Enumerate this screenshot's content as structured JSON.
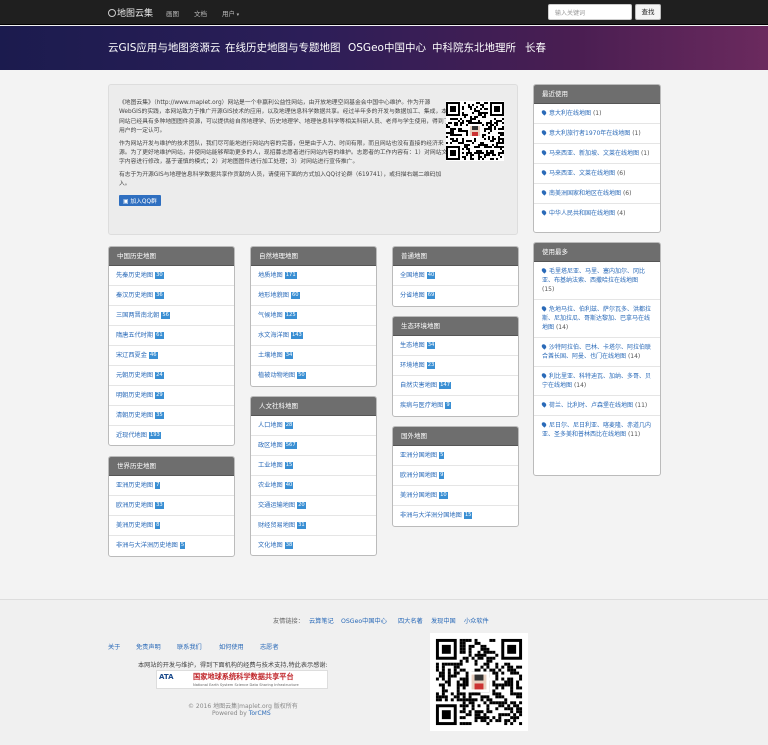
{
  "topbar": {
    "logo": "地图云集",
    "nav": [
      "画图",
      "文档",
      "用户"
    ],
    "search_placeholder": "输入关键词",
    "search_button": "查找"
  },
  "banner": {
    "items": [
      "云GIS应用与地图资源云",
      "在线历史地图与专题地图",
      "OSGeo中国中心",
      "中科院东北地理所",
      "长春"
    ]
  },
  "intro": {
    "p1": "《地图云集》（http://www.maplet.org）网站是一个非赢利公益性网站，由开放地理空间基金会中国中心维护。作为开源WebGIS的实践，本网站致力于推广开源GIS技术的应用，以及地理信息科学数据共享。经过半年多的开发与数据加工、集成，本网站已经具有多种地图图件资源，可以提供给自然地理学、历史地理学、地理信息科学等相关科研人员、老师与学生使用，得到了用户的一定认可。",
    "p2": "作为网站开发与维护的技术团队，我们尽可能地进行网站内容的完善，但是由于人力、时间有限，而且网站也没有直接的经济来源。为了更好地维护网站，并使网站能够帮助更多的人，现招募志愿者进行网站内容的维护。志愿者的工作内容有：1）对网站文字内容进行修改，基于谨慎的模式；2）对地图图件进行加工处理；3）对网站进行宣传推广。",
    "p3": "有志于为开源GIS与地理信息科学数据共享作贡献的人员，请使用下面的方式加入QQ讨论群（619741），或扫描右端二维码加入。",
    "qq_button": "加入QQ群"
  },
  "categories": [
    {
      "title": "中国历史地图",
      "items": [
        [
          "先秦历史地图",
          "30"
        ],
        [
          "秦汉历史地图",
          "36"
        ],
        [
          "三国两晋南北朝",
          "56"
        ],
        [
          "隋唐五代时期",
          "61"
        ],
        [
          "宋辽西夏金",
          "46"
        ],
        [
          "元朝历史地图",
          "24"
        ],
        [
          "明朝历史地图",
          "29"
        ],
        [
          "清朝历史地图",
          "35"
        ],
        [
          "近现代地图",
          "193"
        ]
      ]
    },
    {
      "title": "世界历史地图",
      "items": [
        [
          "亚洲历史地图",
          "7"
        ],
        [
          "欧洲历史地图",
          "33"
        ],
        [
          "美洲历史地图",
          "8"
        ],
        [
          "非洲与大洋洲历史地图",
          "5"
        ]
      ]
    },
    {
      "title": "自然地理地图",
      "items": [
        [
          "地质地图",
          "171"
        ],
        [
          "地形地貌图",
          "60"
        ],
        [
          "气候地图",
          "125"
        ],
        [
          "水文海洋图",
          "143"
        ],
        [
          "土壤地图",
          "34"
        ],
        [
          "植被动物地图",
          "50"
        ]
      ]
    },
    {
      "title": "人文社科地图",
      "items": [
        [
          "人口地图",
          "28"
        ],
        [
          "政区地图",
          "567"
        ],
        [
          "工业地图",
          "15"
        ],
        [
          "农业地图",
          "40"
        ],
        [
          "交通运输地图",
          "20"
        ],
        [
          "财经贸易地图",
          "31"
        ],
        [
          "文化地图",
          "38"
        ]
      ]
    },
    {
      "title": "普通地图",
      "items": [
        [
          "全国地图",
          "40"
        ],
        [
          "分省地图",
          "69"
        ]
      ]
    },
    {
      "title": "生态环境地图",
      "items": [
        [
          "生态地图",
          "34"
        ],
        [
          "环境地图",
          "23"
        ],
        [
          "自然灾害地图",
          "147"
        ],
        [
          "疾病与医疗地图",
          "9"
        ]
      ]
    },
    {
      "title": "国外地图",
      "items": [
        [
          "亚洲分国地图",
          "5"
        ],
        [
          "欧洲分国地图",
          "9"
        ],
        [
          "美洲分国地图",
          "10"
        ],
        [
          "非洲与大洋洲分国地图",
          "15"
        ]
      ]
    }
  ],
  "recent": {
    "title": "最近使用",
    "items": [
      [
        "意大利在线地图",
        "(1)"
      ],
      [
        "意大利旅行者1970年在线地图",
        "(1)"
      ],
      [
        "马来西亚、新加坡、文莱在线地图",
        "(1)"
      ],
      [
        "马来西亚、文莱在线地图",
        "(6)"
      ],
      [
        "南美洲国家和地区在线地图",
        "(6)"
      ],
      [
        "中华人民共和国在线地图",
        "(4)"
      ]
    ]
  },
  "most": {
    "title": "使用最多",
    "items": [
      [
        "毛里塔尼亚、马里、塞内加尔、冈比亚、布基纳法索、西撒哈拉在线地图",
        "(15)"
      ],
      [
        "危地马拉、伯利兹、萨尔瓦多、洪都拉斯、尼加拉瓜、哥斯达黎加、巴拿马在线地图",
        "(14)"
      ],
      [
        "沙特阿拉伯、巴林、卡塔尔、阿拉伯联合酋长国、阿曼、也门在线地图",
        "(14)"
      ],
      [
        "利比里亚、科特迪瓦、加纳、多哥、贝宁在线地图",
        "(14)"
      ],
      [
        "荷兰、比利时、卢森堡在线地图",
        "(11)"
      ],
      [
        "尼日尔、尼日利亚、喀麦隆、赤道几内亚、圣多美和普林西比在线地图",
        "(11)"
      ]
    ]
  },
  "footer": {
    "links_label": "友情链接：",
    "links": [
      "云算笔记",
      "OSGeo中国中心",
      "四大名著",
      "发现中国",
      "小众软件"
    ],
    "nav": [
      "关于",
      "免责声明",
      "联系我们",
      "如何使用",
      "志愿者"
    ],
    "support": "本网站的开发与维护，得到下面机构的经费与技术支持,特此表示感谢:",
    "logo_abbr": "ATA",
    "logo_title": "国家地球系统科学数据共享平台",
    "logo_sub": "National Earth System Science Data Sharing Infrastructure",
    "copyright": "© 2016 地图云集|maplet.org 版权所有",
    "powered_label": "Powered by",
    "powered_link": "TorCMS"
  }
}
